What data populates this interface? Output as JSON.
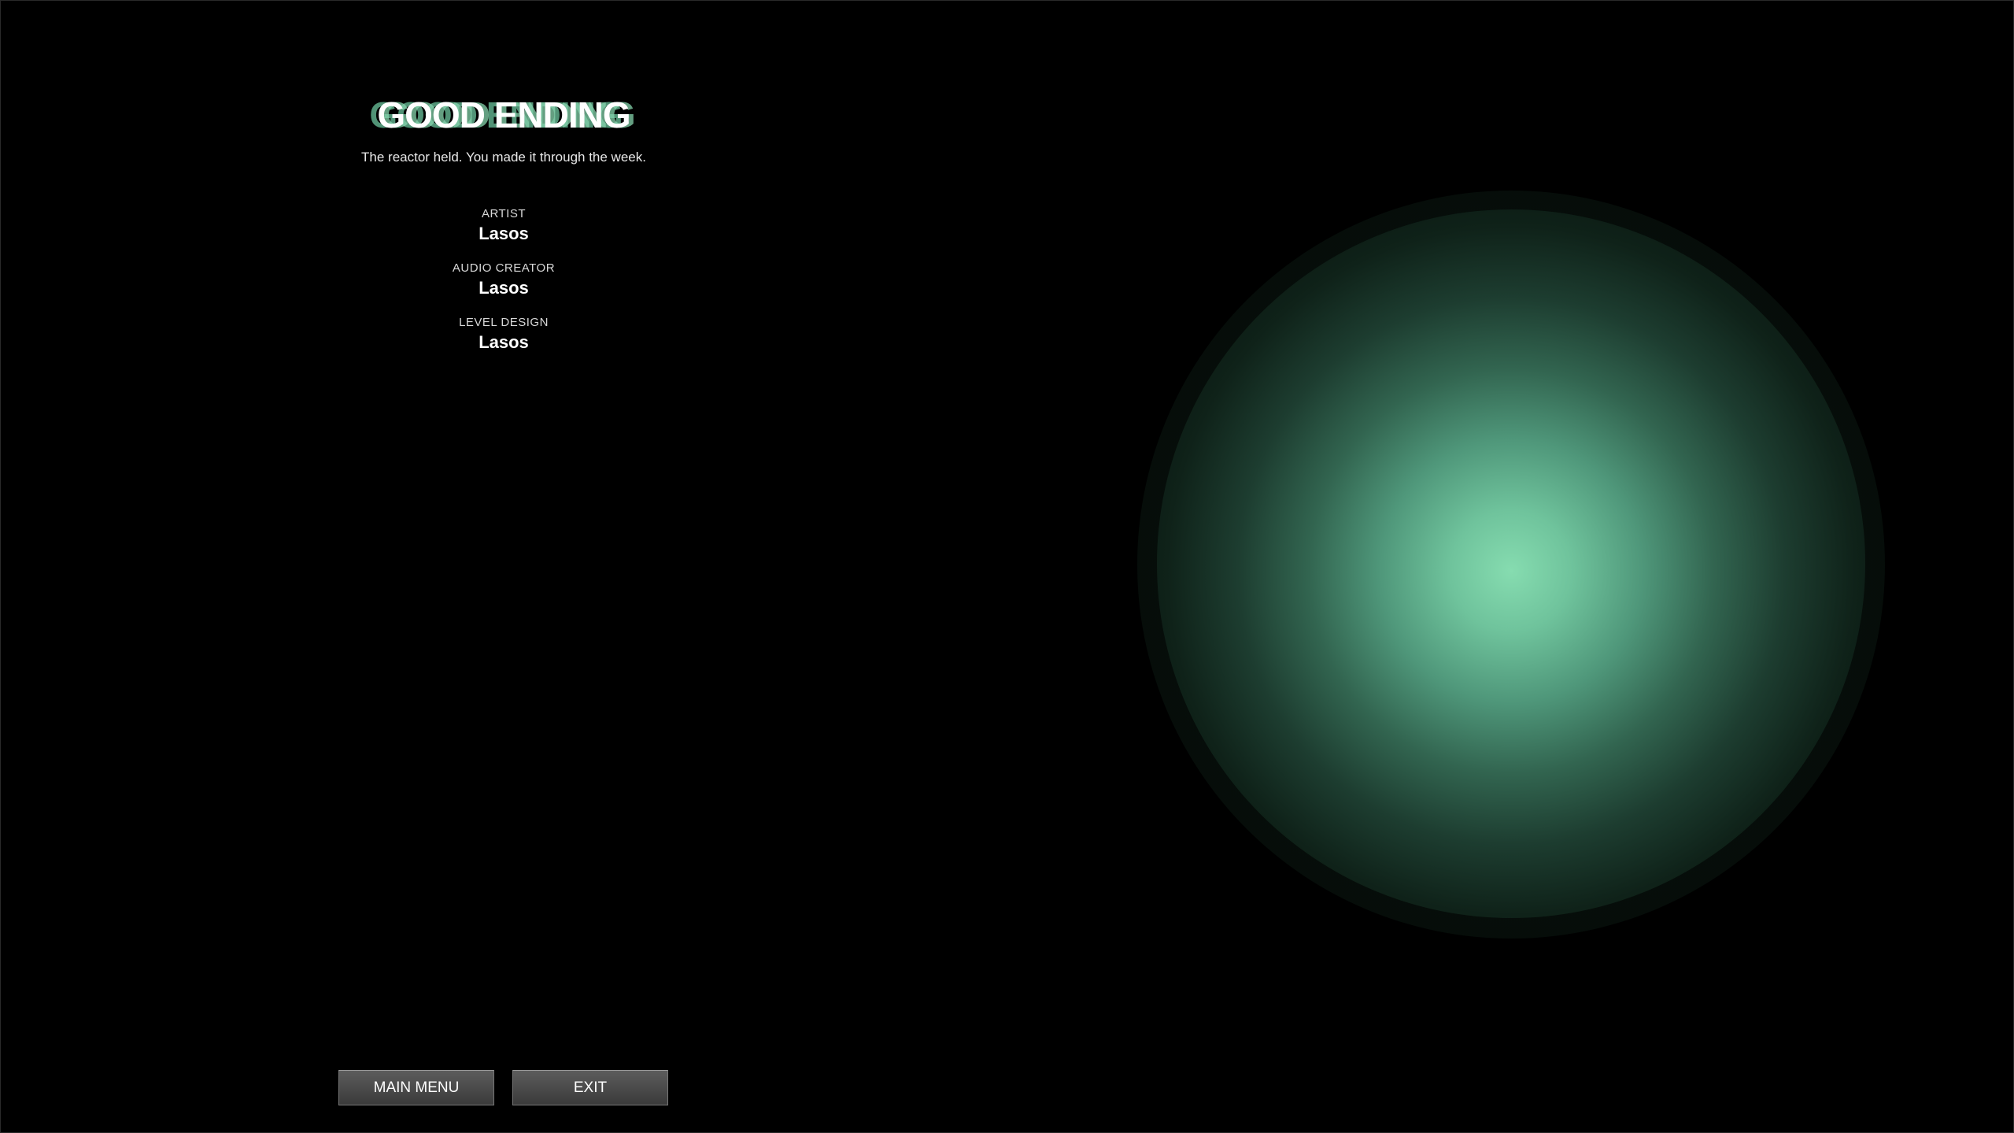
{
  "ending": {
    "title": "GOOD ENDING",
    "subtitle": "The reactor held. You made it through the week."
  },
  "credits": [
    {
      "role": "ARTIST",
      "name": "Lasos"
    },
    {
      "role": "AUDIO CREATOR",
      "name": "Lasos"
    },
    {
      "role": "LEVEL DESIGN",
      "name": "Lasos"
    }
  ],
  "buttons": {
    "main_menu": "MAIN MENU",
    "exit": "EXIT"
  },
  "colors": {
    "background": "#000000",
    "accent": "#86dcb0",
    "button": "#4a4a4a"
  }
}
